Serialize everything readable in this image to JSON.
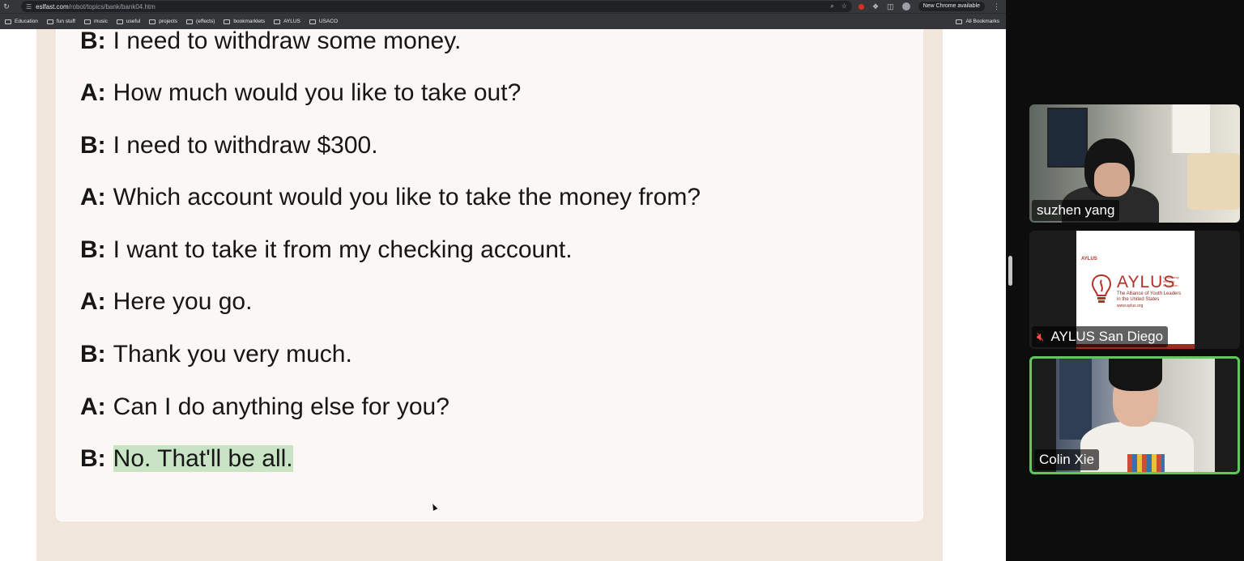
{
  "browser": {
    "url_host": "eslfast.com",
    "url_path": "/robot/topics/bank/bank04.htm",
    "update_button": "New Chrome available",
    "bookmarks": [
      "Education",
      "fun stuff",
      "music",
      "useful",
      "projects",
      "(effects)",
      "bookmarklets",
      "AYLUS",
      "USACO"
    ],
    "all_bookmarks": "All Bookmarks"
  },
  "dialogue": [
    {
      "speaker": "B:",
      "text": "I need to withdraw some money."
    },
    {
      "speaker": "A:",
      "text": "How much would you like to take out?"
    },
    {
      "speaker": "B:",
      "text": "I need to withdraw $300."
    },
    {
      "speaker": "A:",
      "text": "Which account would you like to take the money from?"
    },
    {
      "speaker": "B:",
      "text": "I want to take it from my checking account."
    },
    {
      "speaker": "A:",
      "text": "Here you go."
    },
    {
      "speaker": "B:",
      "text": "Thank you very much."
    },
    {
      "speaker": "A:",
      "text": "Can I do anything else for you?"
    },
    {
      "speaker": "B:",
      "text": "No. That'll be all."
    }
  ],
  "participants": [
    {
      "name": "suzhen  yang"
    },
    {
      "name": "AYLUS San Diego",
      "muted": true
    },
    {
      "name": "Colin Xie",
      "active_speaker": true
    }
  ],
  "logo": {
    "small": "AYLUS",
    "word": "AYLUS",
    "tagline": [
      "Leadership",
      "Integrity",
      "Innovation"
    ],
    "subtitle": [
      "The Alliance of Youth Leaders",
      "in the United States"
    ],
    "url": "www.aylus.org"
  },
  "colors": {
    "highlight": "#c9e3c5",
    "active_border": "#5ec85a",
    "page_background": "#f1e6dc",
    "card_background": "#fbf7f4",
    "brand_red": "#b33228"
  }
}
